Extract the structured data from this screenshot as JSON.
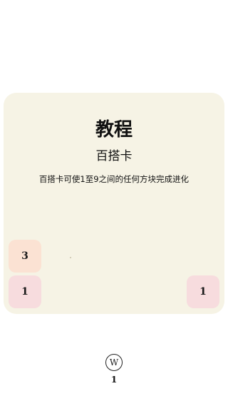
{
  "tutorial": {
    "title": "教程",
    "card_name": "百搭卡",
    "description": "百搭卡可使1至9之间的任何方块完成进化"
  },
  "board": {
    "tiles": [
      {
        "value": "3",
        "color": "#fbe2d3"
      },
      {
        "value": "1",
        "color": "#f7dcde"
      },
      {
        "value": "1",
        "color": "#f7dcde"
      }
    ]
  },
  "wildcard_counter": {
    "icon": "W",
    "count": "1"
  },
  "colors": {
    "card_background": "#f6f3e5",
    "page_background": "#ffffff"
  }
}
